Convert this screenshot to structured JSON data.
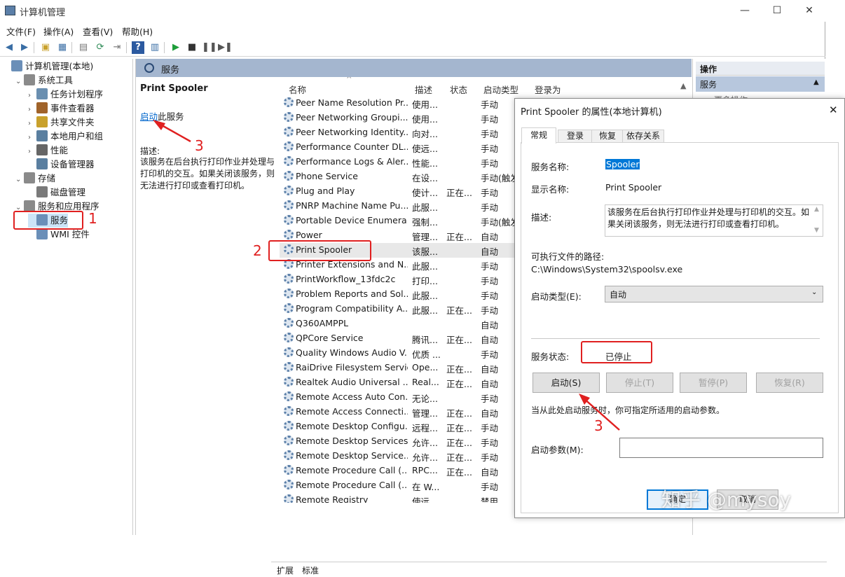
{
  "window": {
    "title": "计算机管理",
    "min": "—",
    "max": "☐",
    "close": "✕"
  },
  "menu": [
    "文件(F)",
    "操作(A)",
    "查看(V)",
    "帮助(H)"
  ],
  "tree": [
    {
      "label": "计算机管理(本地)",
      "level": 0,
      "arrow": ""
    },
    {
      "label": "系统工具",
      "level": 1,
      "arrow": "⌄"
    },
    {
      "label": "任务计划程序",
      "level": 2,
      "arrow": "›"
    },
    {
      "label": "事件查看器",
      "level": 2,
      "arrow": "›"
    },
    {
      "label": "共享文件夹",
      "level": 2,
      "arrow": "›"
    },
    {
      "label": "本地用户和组",
      "level": 2,
      "arrow": "›"
    },
    {
      "label": "性能",
      "level": 2,
      "arrow": "›"
    },
    {
      "label": "设备管理器",
      "level": 2,
      "arrow": ""
    },
    {
      "label": "存储",
      "level": 1,
      "arrow": "⌄"
    },
    {
      "label": "磁盘管理",
      "level": 2,
      "arrow": ""
    },
    {
      "label": "服务和应用程序",
      "level": 1,
      "arrow": "⌄"
    },
    {
      "label": "服务",
      "level": 2,
      "arrow": ""
    },
    {
      "label": "WMI 控件",
      "level": 2,
      "arrow": ""
    }
  ],
  "services_header": "服务",
  "desc_panel": {
    "title": "Print Spooler",
    "start_link": "启动",
    "start_suffix": "此服务",
    "desc_label": "描述:",
    "desc_text": "该服务在后台执行打印作业并处理与打印机的交互。如果关闭该服务，则无法进行打印或查看打印机。"
  },
  "columns": {
    "name": "名称",
    "desc": "描述",
    "status": "状态",
    "startup": "启动类型",
    "logon": "登录为"
  },
  "services": [
    {
      "name": "Peer Name Resolution Pr...",
      "desc": "使用...",
      "status": "",
      "startup": "手动"
    },
    {
      "name": "Peer Networking Groupi...",
      "desc": "使用...",
      "status": "",
      "startup": "手动"
    },
    {
      "name": "Peer Networking Identity...",
      "desc": "向对...",
      "status": "",
      "startup": "手动"
    },
    {
      "name": "Performance Counter DL...",
      "desc": "使远...",
      "status": "",
      "startup": "手动"
    },
    {
      "name": "Performance Logs & Aler...",
      "desc": "性能...",
      "status": "",
      "startup": "手动"
    },
    {
      "name": "Phone Service",
      "desc": "在设...",
      "status": "",
      "startup": "手动(触发"
    },
    {
      "name": "Plug and Play",
      "desc": "使计...",
      "status": "正在...",
      "startup": "手动"
    },
    {
      "name": "PNRP Machine Name Pu...",
      "desc": "此服...",
      "status": "",
      "startup": "手动"
    },
    {
      "name": "Portable Device Enumera...",
      "desc": "强制...",
      "status": "",
      "startup": "手动(触发"
    },
    {
      "name": "Power",
      "desc": "管理...",
      "status": "正在...",
      "startup": "自动"
    },
    {
      "name": "Print Spooler",
      "desc": "该服...",
      "status": "",
      "startup": "自动"
    },
    {
      "name": "Printer Extensions and N...",
      "desc": "此服...",
      "status": "",
      "startup": "手动"
    },
    {
      "name": "PrintWorkflow_13fdc2c",
      "desc": "打印...",
      "status": "",
      "startup": "手动"
    },
    {
      "name": "Problem Reports and Sol...",
      "desc": "此服...",
      "status": "",
      "startup": "手动"
    },
    {
      "name": "Program Compatibility A...",
      "desc": "此服...",
      "status": "正在...",
      "startup": "手动"
    },
    {
      "name": "Q360AMPPL",
      "desc": "",
      "status": "",
      "startup": "自动"
    },
    {
      "name": "QPCore Service",
      "desc": "腾讯...",
      "status": "正在...",
      "startup": "自动"
    },
    {
      "name": "Quality Windows Audio V...",
      "desc": "优质 ...",
      "status": "",
      "startup": "手动"
    },
    {
      "name": "RaiDrive Filesystem Service",
      "desc": "Ope...",
      "status": "正在...",
      "startup": "自动"
    },
    {
      "name": "Realtek Audio Universal ...",
      "desc": "Real...",
      "status": "正在...",
      "startup": "自动"
    },
    {
      "name": "Remote Access Auto Con...",
      "desc": "无论...",
      "status": "",
      "startup": "手动"
    },
    {
      "name": "Remote Access Connecti...",
      "desc": "管理...",
      "status": "正在...",
      "startup": "自动"
    },
    {
      "name": "Remote Desktop Configu...",
      "desc": "远程...",
      "status": "正在...",
      "startup": "手动"
    },
    {
      "name": "Remote Desktop Services",
      "desc": "允许...",
      "status": "正在...",
      "startup": "手动"
    },
    {
      "name": "Remote Desktop Service...",
      "desc": "允许...",
      "status": "正在...",
      "startup": "手动"
    },
    {
      "name": "Remote Procedure Call (...",
      "desc": "RPC...",
      "status": "正在...",
      "startup": "自动"
    },
    {
      "name": "Remote Procedure Call (...",
      "desc": "在 W...",
      "status": "",
      "startup": "手动"
    },
    {
      "name": "Remote Registry",
      "desc": "使远...",
      "status": "",
      "startup": "禁用"
    }
  ],
  "bottom_tabs": [
    "扩展",
    "标准"
  ],
  "actions": {
    "title": "操作",
    "section": "服务",
    "sub": "更多操作"
  },
  "dialog": {
    "title": "Print Spooler 的属性(本地计算机)",
    "tabs": [
      "常规",
      "登录",
      "恢复",
      "依存关系"
    ],
    "service_name_label": "服务名称:",
    "service_name": "Spooler",
    "display_name_label": "显示名称:",
    "display_name": "Print Spooler",
    "desc_label": "描述:",
    "desc": "该服务在后台执行打印作业并处理与打印机的交互。如果关闭该服务，则无法进行打印或查看打印机。",
    "path_label": "可执行文件的路径:",
    "path": "C:\\Windows\\System32\\spoolsv.exe",
    "startup_label": "启动类型(E):",
    "startup_value": "自动",
    "status_label": "服务状态:",
    "status_value": "已停止",
    "buttons": [
      "启动(S)",
      "停止(T)",
      "暂停(P)",
      "恢复(R)"
    ],
    "hint": "当从此处启动服务时，你可指定所适用的启动参数。",
    "param_label": "启动参数(M):",
    "ok": "确定",
    "cancel": "取消"
  },
  "annotations": {
    "n1": "1",
    "n2": "2",
    "n3a": "3",
    "n3b": "3"
  },
  "watermark": "知乎 @mysoy",
  "colors": {
    "accent": "#0078d7",
    "header": "#a4b6cf",
    "annotation": "#e02020"
  }
}
